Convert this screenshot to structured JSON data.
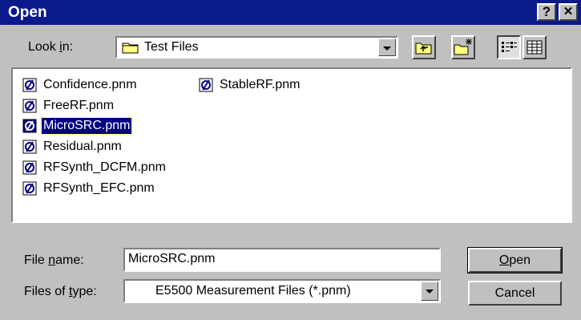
{
  "window": {
    "title": "Open",
    "help_label": "?",
    "close_label": "✕"
  },
  "lookin": {
    "label_pre": "Look ",
    "label_key": "i",
    "label_post": "n:",
    "value": "Test Files"
  },
  "files": [
    {
      "name": "Confidence.pnm",
      "selected": false
    },
    {
      "name": "FreeRF.pnm",
      "selected": false
    },
    {
      "name": "MicroSRC.pnm",
      "selected": true
    },
    {
      "name": "Residual.pnm",
      "selected": false
    },
    {
      "name": "RFSynth_DCFM.pnm",
      "selected": false
    },
    {
      "name": "RFSynth_EFC.pnm",
      "selected": false
    },
    {
      "name": "StableRF.pnm",
      "selected": false
    }
  ],
  "filename": {
    "label_pre": "File ",
    "label_key": "n",
    "label_post": "ame:",
    "value": "MicroSRC.pnm"
  },
  "filetype": {
    "label_pre": "Files of ",
    "label_key": "t",
    "label_post": "ype:",
    "value": "E5500 Measurement Files (*.pnm)"
  },
  "buttons": {
    "open_key": "O",
    "open_rest": "pen",
    "cancel": "Cancel"
  },
  "colors": {
    "titlebar": "#0a1a8a",
    "face": "#c0c0c0",
    "selection": "#000080"
  }
}
